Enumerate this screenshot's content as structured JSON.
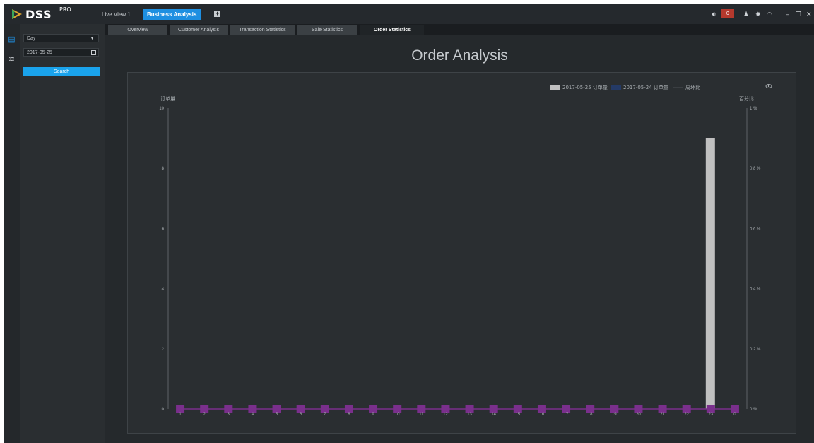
{
  "app": {
    "logo_text": "DSS",
    "logo_sup": "PRO",
    "tabs": [
      "Live View 1",
      "Business Analysis"
    ],
    "alarm_count": "0"
  },
  "left_panel": {
    "period": "Day",
    "date": "2017-05-25",
    "search_label": "Search"
  },
  "subtabs": [
    "Overview",
    "Customer Analysis",
    "Transaction Statistics",
    "Sale Statistics",
    "Order Statistics"
  ],
  "page_title": "Order Analysis",
  "colors": {
    "accent": "#1e8fe1",
    "bar_current": "#c0c0c0",
    "bar_previous": "#243a66",
    "line_ratio": "#7a2f8c"
  },
  "chart_data": {
    "type": "bar",
    "legend": [
      "2017-05-25 订单量",
      "2017-05-24 订单量",
      "周环比"
    ],
    "ylabel_left": "订单量",
    "ylabel_right": "百分比",
    "ylim": [
      0,
      10
    ],
    "yticks": [
      "0",
      "2",
      "4",
      "6",
      "8",
      "10"
    ],
    "ylim_right": [
      0,
      1
    ],
    "yticks_right": [
      "0 %",
      "0.2 %",
      "0.4 %",
      "0.6 %",
      "0.8 %",
      "1 %"
    ],
    "categories": [
      "1",
      "2",
      "3",
      "4",
      "5",
      "6",
      "7",
      "8",
      "9",
      "10",
      "11",
      "12",
      "13",
      "14",
      "15",
      "16",
      "17",
      "18",
      "19",
      "20",
      "21",
      "22",
      "23",
      "0"
    ],
    "series": [
      {
        "name": "2017-05-25 订单量",
        "type": "bar",
        "values": [
          0,
          0,
          0,
          0,
          0,
          0,
          0,
          0,
          0,
          0,
          0,
          0,
          0,
          0,
          0,
          0,
          0,
          0,
          0,
          0,
          0,
          0,
          9,
          0
        ]
      },
      {
        "name": "2017-05-24 订单量",
        "type": "bar",
        "values": [
          0,
          0,
          0,
          0,
          0,
          0,
          0,
          0,
          0,
          0,
          0,
          0,
          0,
          0,
          0,
          0,
          0,
          0,
          0,
          0,
          0,
          0,
          0,
          0
        ]
      },
      {
        "name": "周环比",
        "type": "line",
        "values": [
          0,
          0,
          0,
          0,
          0,
          0,
          0,
          0,
          0,
          0,
          0,
          0,
          0,
          0,
          0,
          0,
          0,
          0,
          0,
          0,
          0,
          0,
          0,
          0
        ]
      }
    ],
    "legend_position": "top-right",
    "grid": false
  }
}
